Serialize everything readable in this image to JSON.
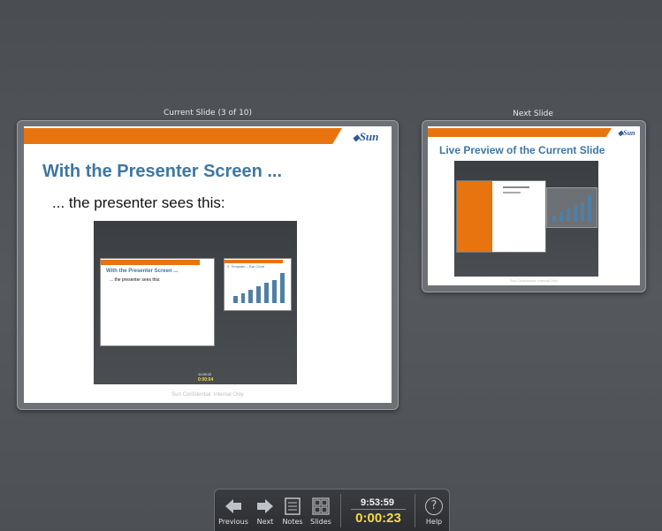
{
  "current_slide": {
    "label": "Current Slide (3 of 10)",
    "title": "With the Presenter Screen ...",
    "subtitle": "... the presenter sees this:",
    "footer": "Sun Confidential: Internal Only",
    "logo": "Sun",
    "embedded_screenshot": {
      "current_title": "With the Presenter Screen ...",
      "current_subtitle": "... the presenter sees this:",
      "next_title": "9. Template – Bar Chart",
      "clock": "11:05:12",
      "timer": "0:00:04",
      "bar_values": [
        2,
        3,
        4,
        5,
        6,
        7,
        9
      ]
    }
  },
  "next_slide": {
    "label": "Next Slide",
    "title": "Live Preview of the Current Slide",
    "footer": "Sun Confidential: Internal Only",
    "logo": "Sun",
    "bar_values": [
      2,
      3,
      4,
      5,
      6,
      8
    ]
  },
  "toolbar": {
    "previous": "Previous",
    "next": "Next",
    "notes": "Notes",
    "slides": "Slides",
    "clock": "9:53:59",
    "timer": "0:00:23",
    "help": "Help",
    "help_glyph": "?"
  },
  "colors": {
    "accent_orange": "#e8740f",
    "title_blue": "#3d77a3",
    "timer_yellow": "#f5d94a"
  }
}
